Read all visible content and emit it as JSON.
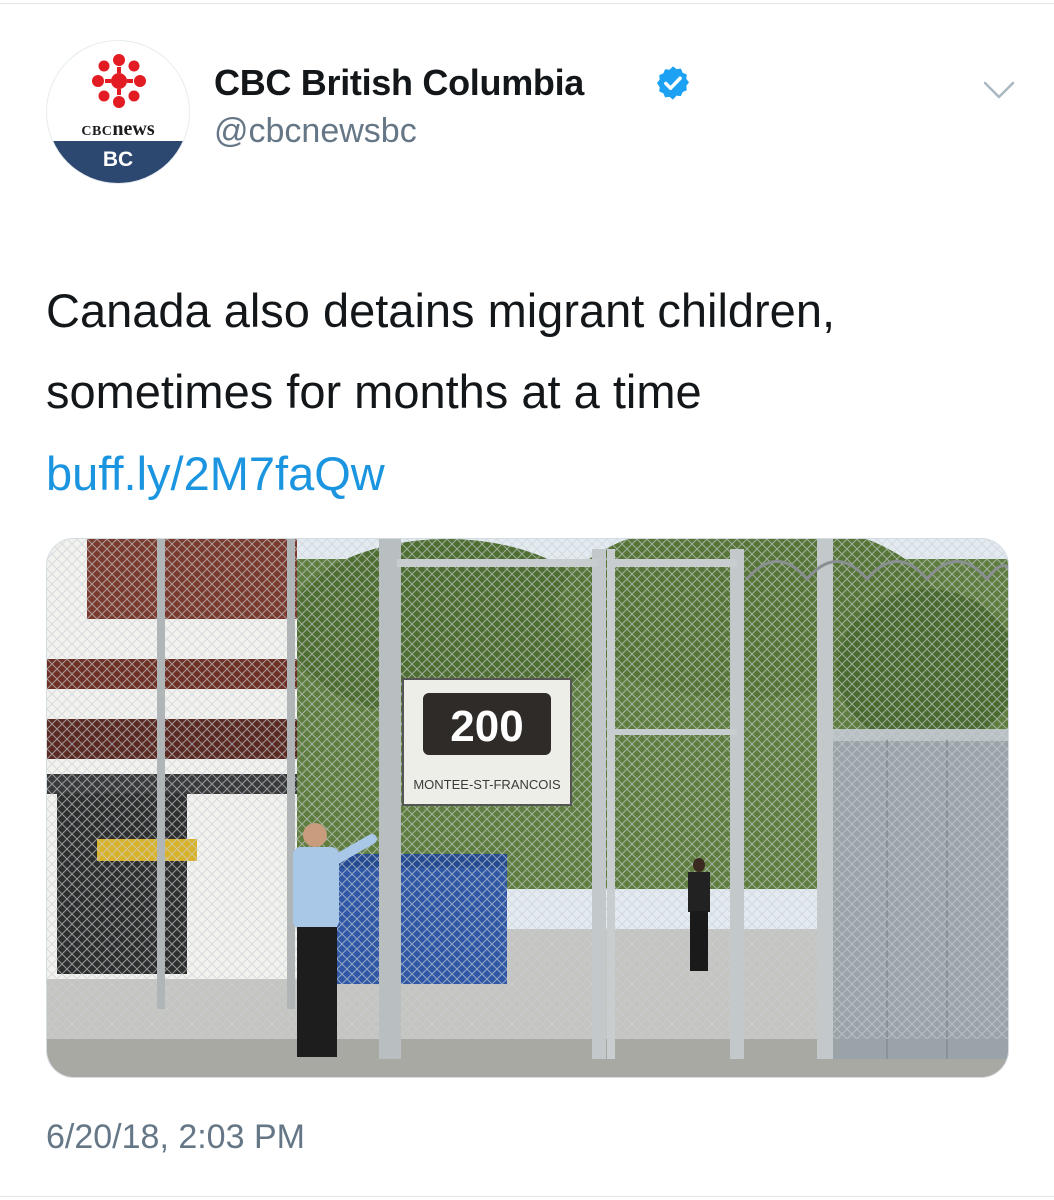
{
  "account": {
    "display_name": "CBC British Columbia",
    "handle": "@cbcnewsbc",
    "verified": true,
    "avatar": {
      "wordmark_prefix": "CBC",
      "wordmark_main": "news",
      "region": "BC",
      "icon": "cbc-gem-icon"
    }
  },
  "menu": {
    "icon": "chevron-down-icon"
  },
  "tweet": {
    "text_line1": "Canada also detains migrant children,",
    "text_line2": "sometimes for months at a time",
    "link": "buff.ly/2M7faQw",
    "timestamp": "6/20/18, 2:03 PM"
  },
  "photo": {
    "sign_number": "200",
    "sign_street": "MONTEE-ST-FRANCOIS"
  },
  "colors": {
    "link": "#1b95e0",
    "secondary_text": "#657786",
    "verified_badge": "#1da1f2",
    "cbc_red": "#e31b23",
    "bc_band": "#2c4770"
  }
}
